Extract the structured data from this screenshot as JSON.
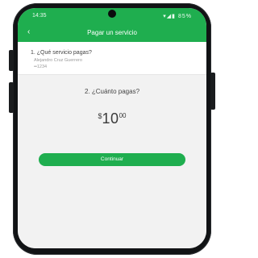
{
  "statusbar": {
    "time": "14:35",
    "icons": "▾◢▮ 85%"
  },
  "appbar": {
    "back_icon": "‹",
    "title": "Pagar un servicio"
  },
  "step1": {
    "title": "1. ¿Qué servicio pagas?",
    "subtitle_line1": "Alejandro Cruz Guerrero",
    "subtitle_line2": "••1234"
  },
  "step2": {
    "title": "2. ¿Cuánto pagas?"
  },
  "amount": {
    "currency": "$",
    "main": "10",
    "cents": "00"
  },
  "actions": {
    "continue_label": "Continuar"
  },
  "colors": {
    "brand_green": "#1fae4f"
  }
}
